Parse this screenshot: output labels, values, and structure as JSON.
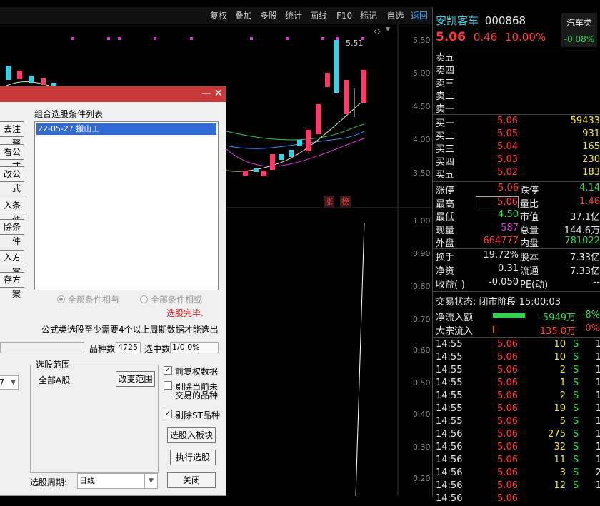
{
  "toolbar": {
    "items": [
      "复权",
      "叠加",
      "多股",
      "统计",
      "画线",
      "F10",
      "标记",
      "-自选",
      "返回"
    ]
  },
  "chart": {
    "price_label": "5.51",
    "y_labels": [
      "5.50",
      "5.00",
      "4.50",
      "4.00",
      "3.50"
    ],
    "ind_labels": [
      "1.00",
      "0.90",
      "0.80",
      "0.70",
      "0.60",
      "0.50",
      "0.40",
      "0.30",
      "0.20"
    ],
    "tags": [
      "涨",
      "榜"
    ]
  },
  "dialog": {
    "side_buttons": [
      "去注释",
      "看公式",
      "改公式",
      "入条件",
      "除条件",
      "入方案",
      "存方案"
    ],
    "list_title": "组合选股条件列表",
    "list_items": [
      "22-05-27 搬山工"
    ],
    "radio_all_and": "全部条件相与",
    "radio_all_or": "全部条件相或",
    "status": "选股完毕.",
    "note": "公式类选股至少需要4个以上周期数据才能选出",
    "count_label": "品种数",
    "count_value": "4725",
    "selected_label": "选中数",
    "selected_value": "1/0.0%",
    "combo_value": "7",
    "range_label": "选股范围",
    "range_value": "全部A股",
    "change_range": "改变范围",
    "chk_fq": "前复权数据",
    "chk_exclude_line1": "剔除当前未",
    "chk_exclude_line2": "交易的品种",
    "chk_st": "剔除ST品种",
    "btn_to_block": "选股入板块",
    "btn_run": "执行选股",
    "btn_close": "关闭",
    "period_label": "选股周期:",
    "period_value": "日线"
  },
  "quote": {
    "name": "安凯客车",
    "code": "000868",
    "sector": "汽车类",
    "sector_change": "-0.08%",
    "price": "5.06",
    "change": "0.46",
    "pct": "10.00%",
    "asks": [
      "卖五",
      "卖四",
      "卖三",
      "卖二",
      "卖一"
    ],
    "bids": [
      {
        "label": "买一",
        "price": "5.06",
        "vol": "59433"
      },
      {
        "label": "买二",
        "price": "5.05",
        "vol": "931"
      },
      {
        "label": "买三",
        "price": "5.04",
        "vol": "165"
      },
      {
        "label": "买四",
        "price": "5.03",
        "vol": "230"
      },
      {
        "label": "买五",
        "price": "5.02",
        "vol": "183"
      }
    ],
    "stats": [
      {
        "l1": "涨停",
        "v1": "5.06",
        "l2": "跌停",
        "v2": "4.14"
      },
      {
        "l1": "最高",
        "v1": "5.06",
        "l2": "量比",
        "v2": "1.46"
      },
      {
        "l1": "最低",
        "v1": "4.50",
        "l2": "市值",
        "v2": "37.1亿"
      },
      {
        "l1": "现量",
        "v1": "587",
        "l2": "总量",
        "v2": "144.6万"
      },
      {
        "l1": "外盘",
        "v1": "664777",
        "l2": "内盘",
        "v2": "781022"
      }
    ],
    "stats2": [
      {
        "l1": "换手",
        "v1": "19.72%",
        "l2": "股本",
        "v2": "7.33亿"
      },
      {
        "l1": "净资",
        "v1": "0.31",
        "l2": "流通",
        "v2": "7.33亿"
      },
      {
        "l1": "收益(-)",
        "v1": "-0.050",
        "l2": "PE(动)",
        "v2": "--"
      }
    ],
    "trade_status": "交易状态: 闭市阶段 15:00:03",
    "netflow_label": "净流入额",
    "netflow_value": "-5949万",
    "netflow_pct": "-8%",
    "bigflow_label": "大宗流入",
    "bigflow_value": "135.0万",
    "bigflow_pct": "0%",
    "ticks": [
      {
        "t": "14:55",
        "p": "5.06",
        "v": "10",
        "s": "S",
        "n": "1"
      },
      {
        "t": "14:55",
        "p": "5.06",
        "v": "10",
        "s": "S",
        "n": "1"
      },
      {
        "t": "14:55",
        "p": "5.06",
        "v": "2",
        "s": "S",
        "n": "1"
      },
      {
        "t": "14:55",
        "p": "5.06",
        "v": "1",
        "s": "S",
        "n": "1"
      },
      {
        "t": "14:55",
        "p": "5.06",
        "v": "2",
        "s": "S",
        "n": "1"
      },
      {
        "t": "14:55",
        "p": "5.06",
        "v": "19",
        "s": "S",
        "n": "1"
      },
      {
        "t": "14:55",
        "p": "5.06",
        "v": "5",
        "s": "S",
        "n": "1"
      },
      {
        "t": "14:56",
        "p": "5.06",
        "v": "275",
        "s": "S",
        "n": "1"
      },
      {
        "t": "14:56",
        "p": "5.06",
        "v": "32",
        "s": "S",
        "n": "1"
      },
      {
        "t": "14:56",
        "p": "5.06",
        "v": "11",
        "s": "S",
        "n": "1"
      },
      {
        "t": "14:56",
        "p": "5.06",
        "v": "3",
        "s": "S",
        "n": "2"
      },
      {
        "t": "14:56",
        "p": "5.06",
        "v": "12",
        "s": "S",
        "n": "1"
      },
      {
        "t": "14:56",
        "p": "5.06",
        "v": "",
        "s": "",
        "n": ""
      }
    ]
  }
}
